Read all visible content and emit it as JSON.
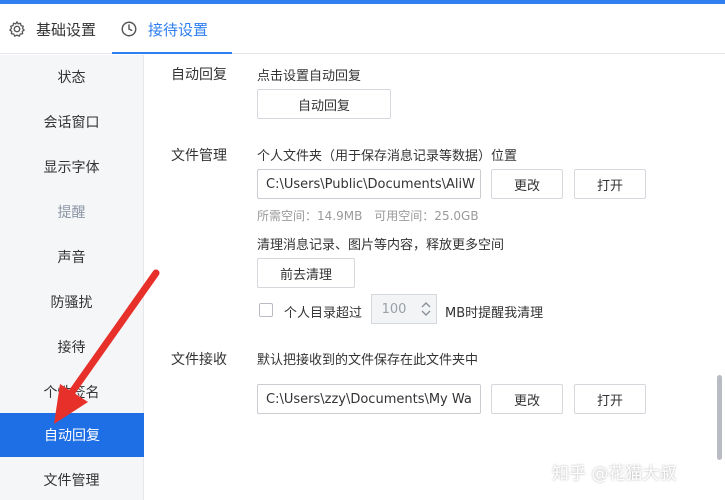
{
  "tabs": {
    "basic_label": "基础设置",
    "reception_label": "接待设置"
  },
  "sidebar": {
    "items": [
      {
        "label": "状态"
      },
      {
        "label": "会话窗口"
      },
      {
        "label": "显示字体"
      },
      {
        "label": "提醒"
      },
      {
        "label": "声音"
      },
      {
        "label": "防骚扰"
      },
      {
        "label": "接待"
      },
      {
        "label": "个性签名"
      },
      {
        "label": "自动回复"
      },
      {
        "label": "文件管理"
      }
    ]
  },
  "auto_reply": {
    "section_label": "自动回复",
    "hint": "点击设置自动回复",
    "button_label": "自动回复"
  },
  "file_mgmt": {
    "section_label": "文件管理",
    "folder_title": "个人文件夹（用于保存消息记录等数据）位置",
    "folder_path": "C:\\Users\\Public\\Documents\\AliW",
    "change_label": "更改",
    "open_label": "打开",
    "space_info": "所需空间：14.9MB　可用空间：25.0GB",
    "clean_hint": "清理消息记录、图片等内容，释放更多空间",
    "clean_button": "前去清理",
    "threshold_prefix": "个人目录超过",
    "threshold_value": "100",
    "threshold_suffix": "MB时提醒我清理"
  },
  "file_recv": {
    "section_label": "文件接收",
    "hint": "默认把接收到的文件保存在此文件夹中",
    "folder_path": "C:\\Users\\zzy\\Documents\\My Wa",
    "change_label": "更改",
    "open_label": "打开"
  },
  "watermark": "知乎 @花猫大叔",
  "colors": {
    "accent": "#2f7ff0",
    "active_bg": "#1e6fe6",
    "arrow": "#e8302a"
  }
}
